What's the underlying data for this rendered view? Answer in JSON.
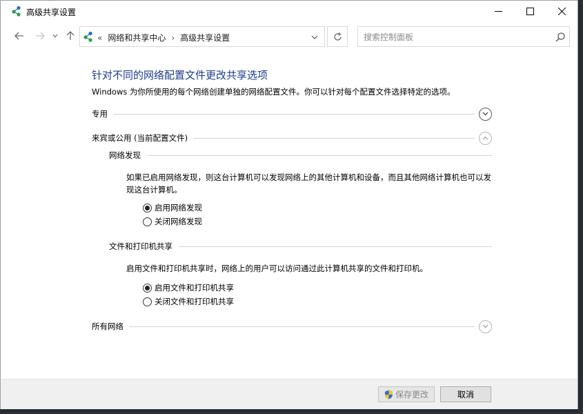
{
  "window": {
    "title": "高级共享设置"
  },
  "nav": {
    "breadcrumb_overflow": "«",
    "breadcrumb": [
      "网络和共享中心",
      "高级共享设置"
    ],
    "breadcrumb_separator": "›",
    "search_placeholder": "搜索控制面板"
  },
  "main": {
    "title": "针对不同的网络配置文件更改共享选项",
    "description": "Windows 为你所使用的每个网络创建单独的网络配置文件。你可以针对每个配置文件选择特定的选项。",
    "sections": [
      {
        "label": "专用",
        "expanded": false
      },
      {
        "label": "来宾或公用 (当前配置文件)",
        "expanded": true
      },
      {
        "label": "所有网络",
        "expanded": false
      }
    ],
    "network_discovery": {
      "label": "网络发现",
      "description": "如果已启用网络发现，则这台计算机可以发现网络上的其他计算机和设备，而且其他网络计算机也可以发现这台计算机。",
      "options": [
        {
          "label": "启用网络发现",
          "selected": true
        },
        {
          "label": "关闭网络发现",
          "selected": false
        }
      ]
    },
    "file_printer_sharing": {
      "label": "文件和打印机共享",
      "description": "启用文件和打印机共享时，网络上的用户可以访问通过此计算机共享的文件和打印机。",
      "options": [
        {
          "label": "启用文件和打印机共享",
          "selected": true
        },
        {
          "label": "关闭文件和打印机共享",
          "selected": false
        }
      ]
    }
  },
  "footer": {
    "save_label": "保存更改",
    "cancel_label": "取消"
  },
  "colors": {
    "title_blue": "#1e3b8a",
    "icon_green": "#2e9f4a",
    "icon_blue": "#1f6fc5"
  }
}
